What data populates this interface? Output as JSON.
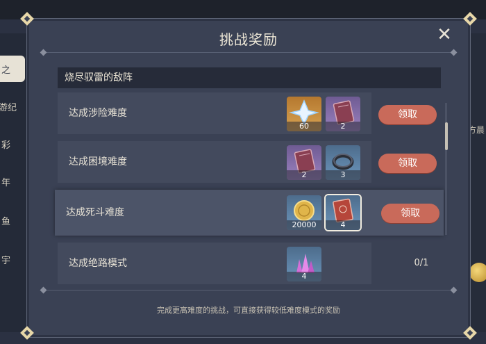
{
  "background": {
    "left_tabs": [
      "之",
      "游纪",
      "彩",
      "年",
      "鱼",
      "宇"
    ],
    "right_text": "方晨"
  },
  "dialog": {
    "title": "挑战奖励",
    "section_title": "烧尽驭雷的敌阵",
    "footer_note": "完成更高难度的挑战，可直接获得较低难度模式的奖励"
  },
  "rows": [
    {
      "label": "达成涉险难度",
      "items": [
        {
          "name": "primogem",
          "count": "60"
        },
        {
          "name": "heros-wit-book",
          "count": "2"
        }
      ],
      "action": "领取"
    },
    {
      "label": "达成困境难度",
      "items": [
        {
          "name": "heros-wit-book",
          "count": "2"
        },
        {
          "name": "ring-material",
          "count": "3"
        }
      ],
      "action": "领取"
    },
    {
      "label": "达成死斗难度",
      "items": [
        {
          "name": "mora",
          "count": "20000"
        },
        {
          "name": "talent-book",
          "count": "4"
        }
      ],
      "action": "领取"
    },
    {
      "label": "达成绝路模式",
      "items": [
        {
          "name": "crystal-ore",
          "count": "4"
        }
      ],
      "progress": "0/1"
    }
  ],
  "colors": {
    "panel": "#3a4154",
    "claim_button": "#c96a5a",
    "text_light": "#ece6d6",
    "item_gold": "#c48a3d",
    "item_purple": "#866fae",
    "item_blue": "#5e84aa"
  }
}
